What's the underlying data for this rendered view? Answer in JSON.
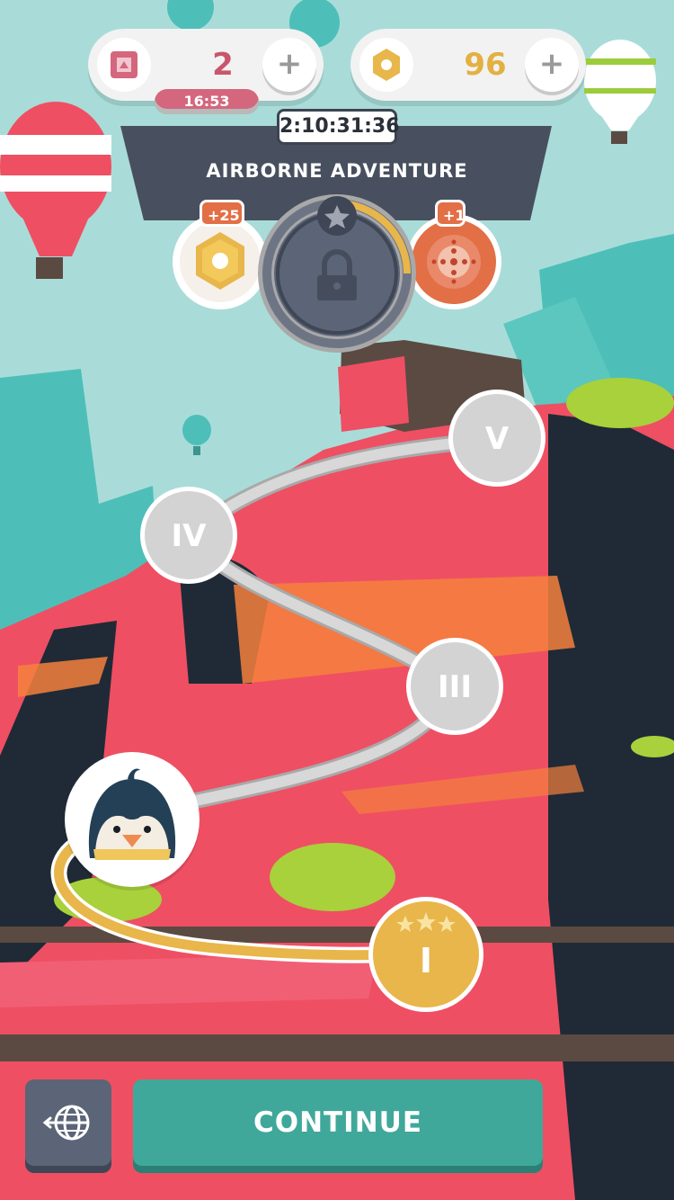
{
  "currency": {
    "tickets": {
      "value": "2",
      "refill_timer": "16:53",
      "plus_label": "+"
    },
    "coins": {
      "value": "96",
      "plus_label": "+"
    }
  },
  "event": {
    "countdown": "2:10:31:36",
    "title": "AIRBORNE ADVENTURE",
    "rewards": [
      {
        "badge": "+25",
        "icon": "hex-coin-icon"
      },
      {
        "badge": "+1",
        "icon": "target-icon"
      }
    ],
    "chest_progress": 0.25
  },
  "levels": [
    {
      "label": "I",
      "state": "completed",
      "stars": 3
    },
    {
      "label": "III",
      "state": "locked"
    },
    {
      "label": "IV",
      "state": "locked"
    },
    {
      "label": "V",
      "state": "locked"
    }
  ],
  "player": {
    "avatar": "penguin-avatar"
  },
  "buttons": {
    "continue": "CONTINUE",
    "map_icon": "globe-icon"
  },
  "colors": {
    "sky": "#a9dcd9",
    "rock": "#ef4f63",
    "gold": "#e8b64a",
    "teal_button": "#3fa89a",
    "panel": "#48505f"
  }
}
